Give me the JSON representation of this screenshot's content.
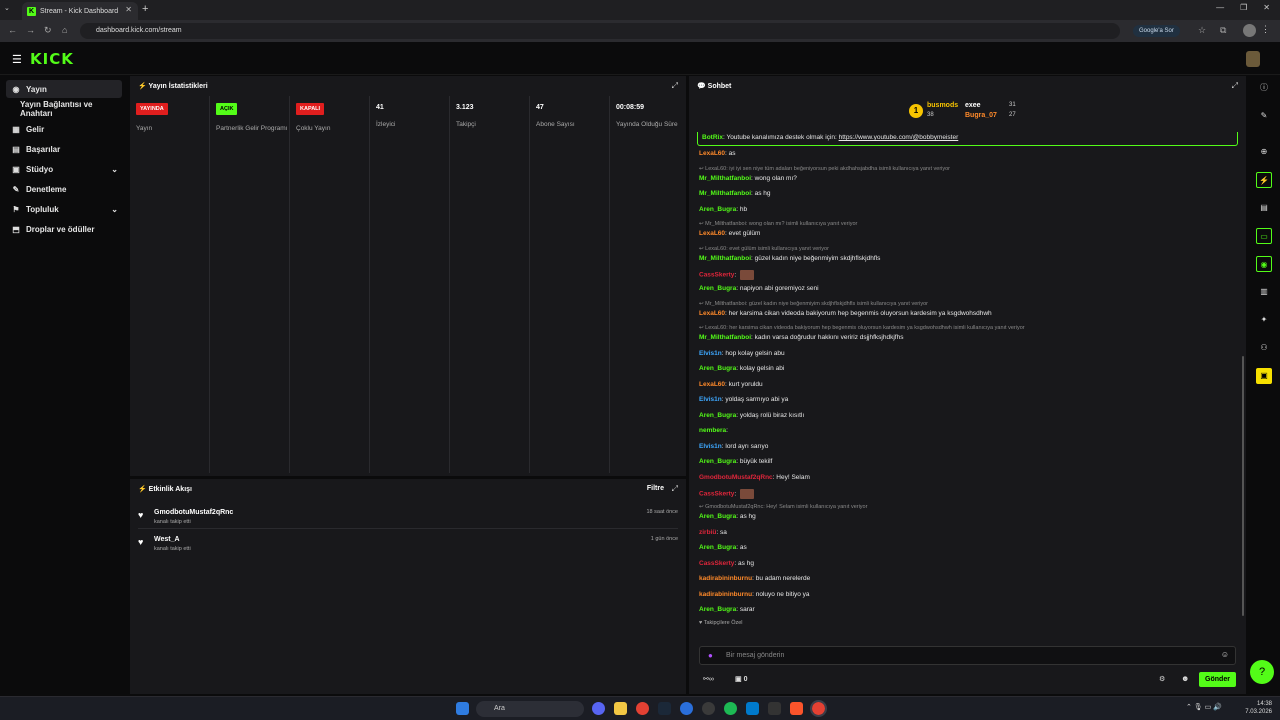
{
  "browser": {
    "tab_title": "Stream - Kick Dashboard",
    "tab_favicon": "K",
    "url": "dashboard.kick.com/stream",
    "google_button": "Google'a Sor"
  },
  "kick": {
    "logo": "KICK"
  },
  "sidebar": {
    "items": [
      {
        "label": "Yayın",
        "icon": "stream-icon"
      },
      {
        "label": "Yayın Bağlantısı ve Anahtarı",
        "icon": ""
      },
      {
        "label": "Gelir",
        "icon": "revenue-icon"
      },
      {
        "label": "Başarılar",
        "icon": "achievements-icon"
      },
      {
        "label": "Stüdyo",
        "icon": "studio-icon"
      },
      {
        "label": "Denetleme",
        "icon": "moderation-icon"
      },
      {
        "label": "Topluluk",
        "icon": "community-icon"
      },
      {
        "label": "Droplar ve ödüller",
        "icon": "drops-icon"
      }
    ]
  },
  "stats": {
    "title": "Yayın İstatistikleri",
    "columns": [
      {
        "badge": "YAYINDA",
        "label": "Yayın",
        "badge_color": "#e01e1e"
      },
      {
        "badge": "AÇIK",
        "label": "Partnerlik Gelir Programı",
        "badge_color": "#53fc18"
      },
      {
        "badge": "KAPALI",
        "label": "Çoklu Yayın",
        "badge_color": "#e01e1e"
      },
      {
        "value": "41",
        "label": "İzleyici"
      },
      {
        "value": "3.123",
        "label": "Takipçi"
      },
      {
        "value": "47",
        "label": "Abone Sayısı"
      },
      {
        "value": "00:08:59",
        "label": "Yayında Olduğu Süre"
      }
    ]
  },
  "activity": {
    "title": "Etkinlik Akışı",
    "filter": "Filtre",
    "rows": [
      {
        "name": "GmodbotuMustaf2qRnc",
        "sub": "kanalı takip etti",
        "time": "18 saat önce"
      },
      {
        "name": "West_A",
        "sub": "kanalı takip etti",
        "time": "1 gün önce"
      }
    ]
  },
  "chat": {
    "title": "Sohbet",
    "leaderboard": [
      {
        "name": "busmods",
        "count": "38"
      },
      {
        "name": "exee",
        "count": "31"
      },
      {
        "name": "Bugra_07",
        "count": "27"
      }
    ],
    "pinned_user": "BotRix",
    "pinned_text": "Youtube kanalımıza destek olmak için:",
    "pinned_link": "https://www.youtube.com/@bobbymeister",
    "messages": [
      {
        "t": "m",
        "u": "LexaL60",
        "c": "#ff8a2a",
        "m": "as"
      },
      {
        "t": "r",
        "m": "LexaL60: iyi iyi sen niye tüm adaları beğeniyorsun peki akdhahsjabdha isimli kullanıcıya yanıt veriyor"
      },
      {
        "t": "m",
        "u": "Mr_Milthatfanboi",
        "c": "#53fc18",
        "m": "wong olan mı?"
      },
      {
        "t": "m",
        "u": "Mr_Milthatfanboi",
        "c": "#53fc18",
        "m": "as hg"
      },
      {
        "t": "m",
        "u": "Aren_Bugra",
        "c": "#53fc18",
        "m": "hb"
      },
      {
        "t": "r",
        "m": "Mr_Milthatfanboi: wong olan mı? isimli kullanıcıya yanıt veriyor"
      },
      {
        "t": "m",
        "u": "LexaL60",
        "c": "#ff8a2a",
        "m": "evet gülüm"
      },
      {
        "t": "r",
        "m": "LexaL60: evet gülüm isimli kullanıcıya yanıt veriyor"
      },
      {
        "t": "m",
        "u": "Mr_Milthatfanboi",
        "c": "#53fc18",
        "m": "güzel kadın niye beğenmiyim skdjhflskjdhfls"
      },
      {
        "t": "e",
        "u": "CassSkerty",
        "c": "#e0263b",
        "m": ""
      },
      {
        "t": "m",
        "u": "Aren_Bugra",
        "c": "#53fc18",
        "m": "napiyon abi goremiyoz seni"
      },
      {
        "t": "r",
        "m": "Mr_Milthatfanboi: güzel kadın niye beğenmiyim skdjhflskjdhfls isimli kullanıcıya yanıt veriyor"
      },
      {
        "t": "m",
        "u": "LexaL60",
        "c": "#ff8a2a",
        "m": "her karsima cikan videoda bakiyorum hep begenmis oluyorsun kardesim ya ksgdwohsdhwh"
      },
      {
        "t": "r",
        "m": "LexaL60: her karsima cikan videoda bakiyorum hep begenmis oluyorsun kardesim ya ksgdwohsdhwh isimli kullanıcıya yanıt veriyor"
      },
      {
        "t": "m",
        "u": "Mr_Milthatfanboi",
        "c": "#53fc18",
        "m": "kadın varsa doğrudur hakkını veririz dsjjhfksjhdkjfhs"
      },
      {
        "t": "m",
        "u": "Elvis1n",
        "c": "#3ea8ff",
        "m": "hop kolay gelsin abu"
      },
      {
        "t": "m",
        "u": "Aren_Bugra",
        "c": "#53fc18",
        "m": "kolay gelsin abi"
      },
      {
        "t": "m",
        "u": "LexaL60",
        "c": "#ff8a2a",
        "m": "kurt yoruldu"
      },
      {
        "t": "m",
        "u": "Elvis1n",
        "c": "#3ea8ff",
        "m": "yoldaş sarmıyo abi ya"
      },
      {
        "t": "m",
        "u": "Aren_Bugra",
        "c": "#53fc18",
        "m": "yoldaş rolü biraz kısıtlı"
      },
      {
        "t": "m",
        "u": "nembera",
        "c": "#53fc18",
        "m": ""
      },
      {
        "t": "m",
        "u": "Elvis1n",
        "c": "#3ea8ff",
        "m": "lord ayrı sarıyo"
      },
      {
        "t": "m",
        "u": "Aren_Bugra",
        "c": "#53fc18",
        "m": "büyük tekilf"
      },
      {
        "t": "m",
        "u": "GmodbotuMustaf2qRnc",
        "c": "#e0263b",
        "m": "Hey! Selam"
      },
      {
        "t": "e",
        "u": "CassSkerty",
        "c": "#e0263b",
        "m": ""
      },
      {
        "t": "r",
        "m": "GmodbotuMustaf2qRnc: Hey! Selam isimli kullanıcıya yanıt veriyor"
      },
      {
        "t": "m",
        "u": "Aren_Bugra",
        "c": "#53fc18",
        "m": "as hg"
      },
      {
        "t": "m",
        "u": "zirbiü",
        "c": "#e0263b",
        "m": "sa"
      },
      {
        "t": "m",
        "u": "Aren_Bugra",
        "c": "#53fc18",
        "m": "as"
      },
      {
        "t": "m",
        "u": "CassSkerty",
        "c": "#e0263b",
        "m": "as hg"
      },
      {
        "t": "m",
        "u": "kadirabininburnu",
        "c": "#ff8a2a",
        "m": "bu adam nerelerde"
      },
      {
        "t": "m",
        "u": "kadirabininburnu",
        "c": "#ff8a2a",
        "m": "noluyo ne bitiyo ya"
      },
      {
        "t": "m",
        "u": "Aren_Bugra",
        "c": "#53fc18",
        "m": "sarar"
      }
    ],
    "followers_only": "Takipçilere Özel",
    "input_placeholder": "Bir mesaj gönderin",
    "points": "0",
    "send_label": "Gönder"
  },
  "taskbar": {
    "search": "Ara",
    "time": "14:38",
    "date": "7.03.2026"
  }
}
